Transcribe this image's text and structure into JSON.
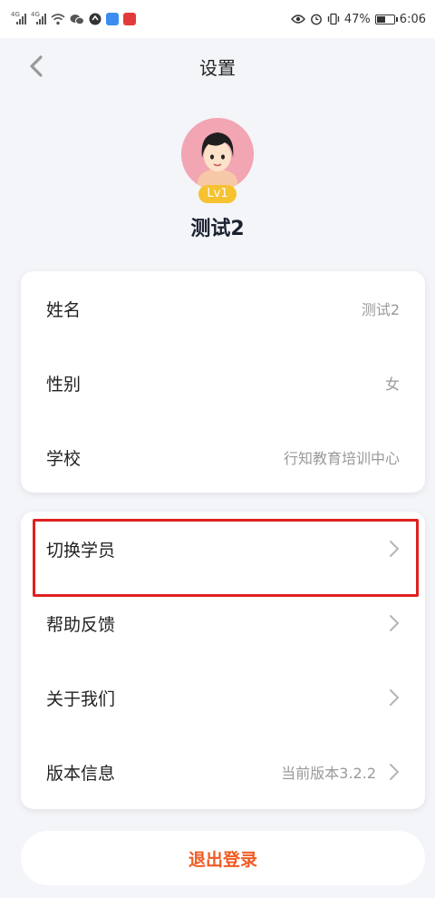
{
  "status_bar": {
    "battery": "47%",
    "time": "6:06",
    "icons": [
      "signal-icon",
      "signal-icon",
      "wifi-icon",
      "wechat-icon",
      "app-icon",
      "app-icon",
      "app-icon",
      "eye-icon",
      "alarm-icon",
      "vibrate-icon",
      "battery-icon"
    ]
  },
  "header": {
    "title": "设置"
  },
  "profile": {
    "level": "Lv1",
    "name": "测试2"
  },
  "info_card": {
    "rows": [
      {
        "label": "姓名",
        "value": "测试2"
      },
      {
        "label": "性别",
        "value": "女"
      },
      {
        "label": "学校",
        "value": "行知教育培训中心"
      }
    ]
  },
  "menu_card": {
    "rows": [
      {
        "label": "切换学员",
        "value": ""
      },
      {
        "label": "帮助反馈",
        "value": ""
      },
      {
        "label": "关于我们",
        "value": ""
      },
      {
        "label": "版本信息",
        "value": "当前版本3.2.2"
      }
    ]
  },
  "logout": {
    "label": "退出登录"
  },
  "colors": {
    "accent": "#f05a22",
    "badge": "#f6c22f",
    "highlight": "#e02020",
    "background": "#f4f5f9"
  }
}
